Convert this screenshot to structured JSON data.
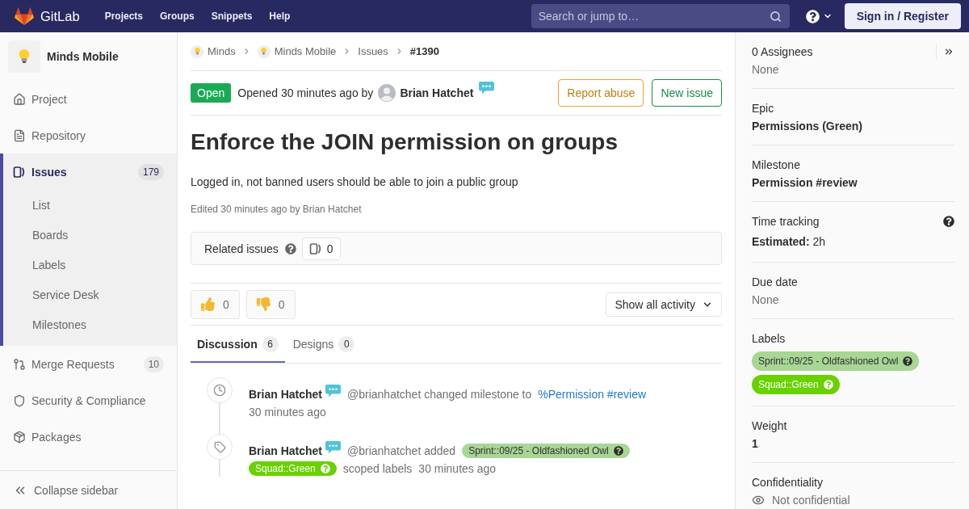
{
  "top_nav": {
    "brand": "GitLab",
    "links": [
      "Projects",
      "Groups",
      "Snippets",
      "Help"
    ],
    "search": {
      "placeholder": "Search or jump to…"
    },
    "sign_in": "Sign in / Register"
  },
  "sidebar": {
    "project": "Minds Mobile",
    "items": [
      {
        "label": "Project",
        "selected": false
      },
      {
        "label": "Repository",
        "selected": false
      },
      {
        "label": "Issues",
        "selected": true,
        "count": "179",
        "children": [
          {
            "label": "List",
            "selected": false
          },
          {
            "label": "Boards",
            "selected": false
          },
          {
            "label": "Labels",
            "selected": false
          },
          {
            "label": "Service Desk",
            "selected": false
          },
          {
            "label": "Milestones",
            "selected": false
          }
        ]
      },
      {
        "label": "Merge Requests",
        "selected": false,
        "count": "10"
      },
      {
        "label": "Security & Compliance",
        "selected": false
      },
      {
        "label": "Packages",
        "selected": false
      }
    ],
    "collapse": "Collapse sidebar"
  },
  "breadcrumbs": [
    {
      "label": "Minds",
      "kind": "group"
    },
    {
      "label": "Minds Mobile",
      "kind": "project"
    },
    {
      "label": "Issues",
      "kind": "page"
    },
    {
      "label": "#1390",
      "kind": "current"
    }
  ],
  "issue": {
    "status": "Open",
    "opened": "Opened 30 minutes ago by",
    "author": "Brian Hatchet",
    "actions": [
      {
        "label": "Report abuse",
        "kind": "warning"
      },
      {
        "label": "New issue",
        "kind": "success"
      }
    ],
    "title": "Enforce the JOIN permission on groups",
    "description": "Logged in, not banned users should be able to join a public group",
    "edited": "Edited 30 minutes ago by Brian Hatchet"
  },
  "related_issues": {
    "label": "Related issues",
    "count": "0"
  },
  "awards": [
    {
      "kind": "thumbs_up",
      "count": "0"
    },
    {
      "kind": "thumbs_down",
      "count": "0"
    }
  ],
  "activity_filter": "Show all activity",
  "tabs": [
    {
      "label": "Discussion",
      "count": "6",
      "selected": true
    },
    {
      "label": "Designs",
      "count": "0",
      "selected": false
    }
  ],
  "timeline": [
    {
      "kind": "milestone",
      "author": "Brian Hatchet",
      "lines": [
        [
          {
            "kind": "text",
            "text": "@brianhatchet changed milestone to"
          },
          {
            "kind": "link",
            "text": "%Permission #review"
          }
        ],
        [
          {
            "kind": "time",
            "text": "30 minutes ago"
          }
        ]
      ]
    },
    {
      "kind": "label",
      "author": "Brian Hatchet",
      "lines": [
        [
          {
            "kind": "text",
            "text": "@brianhatchet added"
          },
          {
            "kind": "label",
            "text": "Sprint::09/25 - Oldfashioned Owl",
            "color": "#a8d695"
          }
        ],
        [
          {
            "kind": "label",
            "text": "Squad::Green",
            "color": "#69d100"
          },
          {
            "kind": "text",
            "text": "scoped labels"
          },
          {
            "kind": "time",
            "text": "30 minutes ago"
          }
        ]
      ]
    }
  ],
  "right_sidebar": [
    {
      "kind": "muted",
      "title": "0 Assignees",
      "value": "None"
    },
    {
      "kind": "bold",
      "title": "Epic",
      "value": "Permissions (Green)"
    },
    {
      "kind": "bold",
      "title": "Milestone",
      "value": "Permission #review"
    },
    {
      "kind": "time",
      "title": "Time tracking",
      "value": "**Estimated:** 2h"
    },
    {
      "kind": "muted",
      "title": "Due date",
      "value": "None"
    },
    {
      "kind": "labels",
      "title": "Labels",
      "labels": [
        {
          "text": "Sprint::09/25 - Oldfashioned Owl",
          "color": "#a8d695"
        },
        {
          "text": "Squad::Green",
          "color": "#69d100"
        }
      ]
    },
    {
      "kind": "bold",
      "title": "Weight",
      "value": "1"
    },
    {
      "kind": "visibility",
      "title": "Confidentiality",
      "value": "Not confidential"
    }
  ]
}
